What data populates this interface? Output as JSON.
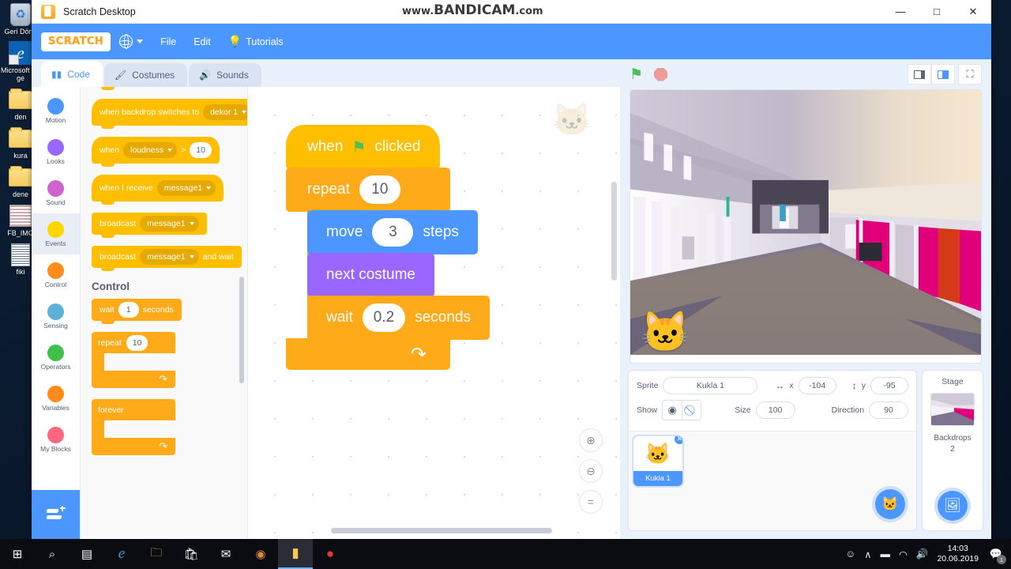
{
  "window": {
    "title": "Scratch Desktop",
    "app_icon": "scratch-app-icon",
    "minimize": "—",
    "maximize": "□",
    "close": "✕"
  },
  "watermark": {
    "prefix": "www.",
    "brand": "BANDICAM",
    "suffix": ".com"
  },
  "menubar": {
    "logo": "SCRATCH",
    "language_icon": "globe-icon",
    "items": [
      {
        "label": "File"
      },
      {
        "label": "Edit"
      }
    ],
    "tutorials": {
      "label": "Tutorials",
      "icon": "lightbulb-icon"
    }
  },
  "tabs": [
    {
      "label": "Code",
      "icon": "code-blocks-icon",
      "active": true
    },
    {
      "label": "Costumes",
      "icon": "paintbrush-icon",
      "active": false
    },
    {
      "label": "Sounds",
      "icon": "speaker-icon",
      "active": false
    }
  ],
  "categories": [
    {
      "label": "Motion",
      "color": "#4c97ff",
      "selected": false
    },
    {
      "label": "Looks",
      "color": "#9966ff",
      "selected": false
    },
    {
      "label": "Sound",
      "color": "#cf63cf",
      "selected": false
    },
    {
      "label": "Events",
      "color": "#ffd500",
      "selected": true
    },
    {
      "label": "Control",
      "color": "#ff8c1a",
      "selected": false
    },
    {
      "label": "Sensing",
      "color": "#5cb1d6",
      "selected": false
    },
    {
      "label": "Operators",
      "color": "#40bf4a",
      "selected": false
    },
    {
      "label": "Variables",
      "color": "#ff8c1a",
      "selected": false
    },
    {
      "label": "My Blocks",
      "color": "#ff6680",
      "selected": false
    }
  ],
  "add_extension": {
    "label": "add-extension",
    "icon": "add-extension-icon"
  },
  "palette": {
    "blocks": {
      "when_backdrop": {
        "text": "when backdrop switches to",
        "dropdown": "dekor 1"
      },
      "when_loudness": {
        "text": "when",
        "dropdown": "loudness",
        "op": ">",
        "value": "10"
      },
      "when_receive": {
        "text": "when I receive",
        "dropdown": "message1"
      },
      "broadcast": {
        "text": "broadcast",
        "dropdown": "message1"
      },
      "broadcast_wait": {
        "text": "broadcast",
        "dropdown": "message1",
        "suffix": "and wait"
      }
    },
    "section_heading": "Control",
    "control_blocks": {
      "wait": {
        "pre": "wait",
        "value": "1",
        "post": "seconds"
      },
      "repeat": {
        "pre": "repeat",
        "value": "10",
        "loop_icon": "loop-arrow-icon"
      },
      "forever": {
        "pre": "forever",
        "loop_icon": "loop-arrow-icon"
      }
    }
  },
  "script": {
    "when_flag": {
      "pre": "when",
      "flag_icon": "green-flag-icon",
      "post": "clicked"
    },
    "repeat": {
      "pre": "repeat",
      "value": "10"
    },
    "move": {
      "pre": "move",
      "value": "3",
      "post": "steps"
    },
    "next_costume": {
      "text": "next costume"
    },
    "wait": {
      "pre": "wait",
      "value": "0.2",
      "post": "seconds"
    },
    "loop_icon": "loop-arrow-icon"
  },
  "canvas": {
    "zoom_in": "+",
    "zoom_out": "−",
    "zoom_reset": "=",
    "watermark_icon": "scratch-cat-watermark"
  },
  "stage_controls": {
    "green_flag": "green-flag-icon",
    "stop": "stop-sign-icon",
    "small_stage": "small-stage-icon",
    "large_stage": "large-stage-icon",
    "fullscreen": "fullscreen-icon"
  },
  "stage": {
    "sprite_icon": "scratch-cat"
  },
  "sprite_info": {
    "sprite_label": "Sprite",
    "sprite_name": "Kukla 1",
    "x_label": "x",
    "x_value": "-104",
    "y_label": "y",
    "y_value": "-95",
    "show_label": "Show",
    "size_label": "Size",
    "size_value": "100",
    "direction_label": "Direction",
    "direction_value": "90",
    "x_icon": "horizontal-arrows-icon",
    "y_icon": "vertical-arrows-icon",
    "show_on_icon": "eye-icon",
    "show_off_icon": "eye-crossed-icon"
  },
  "sprite_list": [
    {
      "name": "Kukla 1",
      "icon": "scratch-cat",
      "delete": "✕",
      "selected": true
    }
  ],
  "add_sprite_button": {
    "icon": "add-sprite-cat-icon"
  },
  "stage_panel": {
    "title": "Stage",
    "backdrops_label": "Backdrops",
    "backdrops_count": "2",
    "add_backdrop_icon": "add-backdrop-icon"
  },
  "desktop_icons": [
    {
      "label": "Geri Dönü",
      "type": "recycle-bin"
    },
    {
      "label": "Microsoft Edge",
      "type": "edge"
    },
    {
      "label": "den",
      "type": "folder"
    },
    {
      "label": "kura",
      "type": "folder-pdf"
    },
    {
      "label": "dene",
      "type": "folder"
    },
    {
      "label": "FB_IMG",
      "type": "image"
    },
    {
      "label": "fiki",
      "type": "document"
    }
  ],
  "taskbar": {
    "items": [
      {
        "name": "start-button",
        "glyph": "⊞"
      },
      {
        "name": "search-button",
        "glyph": "⌕"
      },
      {
        "name": "task-view-button",
        "glyph": "▤"
      },
      {
        "name": "edge-button",
        "glyph": "e"
      },
      {
        "name": "file-explorer-button",
        "glyph": "🗀"
      },
      {
        "name": "microsoft-store-button",
        "glyph": "🛍"
      },
      {
        "name": "mail-button",
        "glyph": "✉"
      },
      {
        "name": "media-button",
        "glyph": "◉"
      },
      {
        "name": "scratch-button",
        "glyph": "▮",
        "active": true
      },
      {
        "name": "bandicam-button",
        "glyph": "●"
      }
    ],
    "tray": [
      {
        "name": "people-icon",
        "glyph": "☺"
      },
      {
        "name": "show-hidden-icons",
        "glyph": "∧"
      },
      {
        "name": "battery-icon",
        "glyph": "▬"
      },
      {
        "name": "wifi-icon",
        "glyph": "◠"
      },
      {
        "name": "volume-icon",
        "glyph": "🔊"
      }
    ],
    "clock": {
      "time": "14:03",
      "date": "20.06.2019"
    },
    "notifications": {
      "icon": "notification-icon",
      "count": "1"
    }
  }
}
